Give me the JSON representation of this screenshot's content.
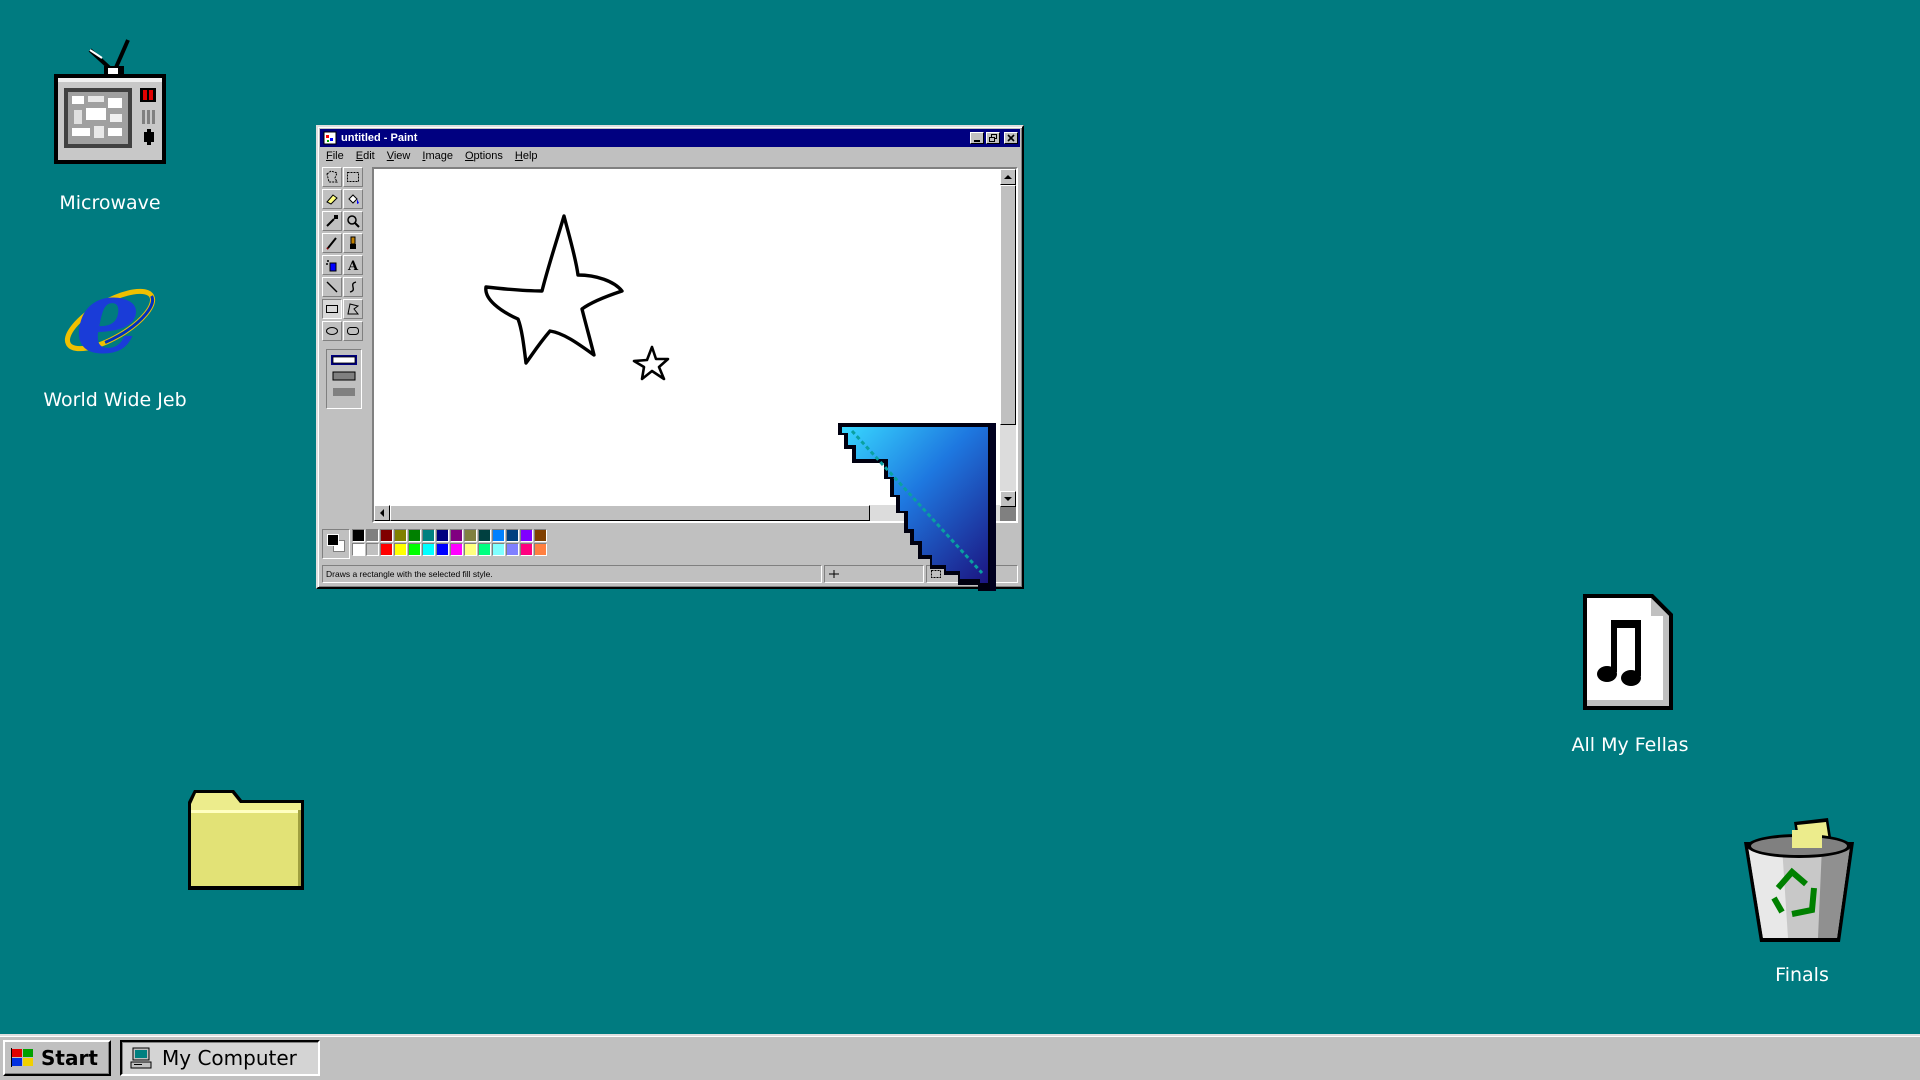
{
  "desktop": {
    "background": "#007b80",
    "icons": {
      "microwave": "Microwave",
      "www": "World Wide Jeb",
      "fellas": "All My Fellas",
      "finals": "Finals"
    }
  },
  "paint": {
    "title": "untitled - Paint",
    "menu": [
      "File",
      "Edit",
      "View",
      "Image",
      "Options",
      "Help"
    ],
    "window_buttons": [
      "minimize",
      "maximize",
      "close"
    ],
    "palette": {
      "row1": [
        "#000000",
        "#808080",
        "#800000",
        "#808000",
        "#008000",
        "#008080",
        "#000080",
        "#800080",
        "#808040",
        "#004040",
        "#0080ff",
        "#004080",
        "#8000ff",
        "#804000"
      ],
      "row2": [
        "#ffffff",
        "#c0c0c0",
        "#ff0000",
        "#ffff00",
        "#00ff00",
        "#00ffff",
        "#0000ff",
        "#ff00ff",
        "#ffff80",
        "#00ff80",
        "#80ffff",
        "#8080ff",
        "#ff0080",
        "#ff8040"
      ]
    },
    "status_text": "Draws a rectangle with the selected fill style."
  },
  "taskbar": {
    "start_label": "Start",
    "task_mycomputer": "My Computer"
  }
}
